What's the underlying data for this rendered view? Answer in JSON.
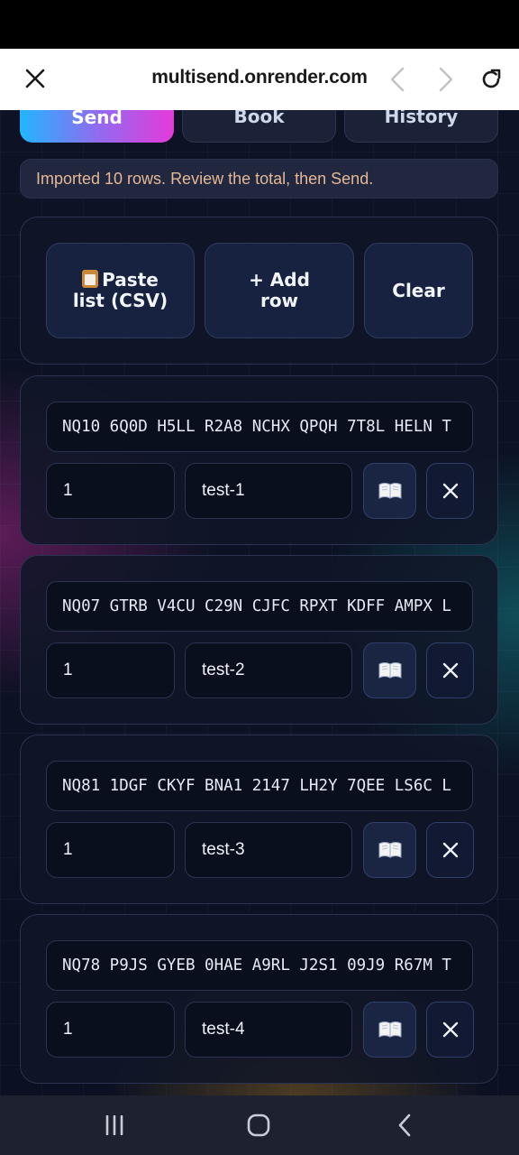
{
  "browser": {
    "url": "multisend.onrender.com"
  },
  "tabs": [
    {
      "label": "Send"
    },
    {
      "label": "Book"
    },
    {
      "label": "History"
    }
  ],
  "notice": "Imported 10 rows. Review the total, then Send.",
  "tools": {
    "paste_label": "Paste list (CSV)",
    "add_label": "+ Add row",
    "clear_label": "Clear"
  },
  "rows": [
    {
      "address": "NQ10 6Q0D H5LL R2A8 NCHX QPQH 7T8L HELN T",
      "amount": "1",
      "memo": "test-1"
    },
    {
      "address": "NQ07 GTRB V4CU C29N CJFC RPXT KDFF AMPX L",
      "amount": "1",
      "memo": "test-2"
    },
    {
      "address": "NQ81 1DGF CKYF BNA1 2147 LH2Y 7QEE LS6C L",
      "amount": "1",
      "memo": "test-3"
    },
    {
      "address": "NQ78 P9JS GYEB 0HAE A9RL J2S1 09J9 R67M T",
      "amount": "1",
      "memo": "test-4"
    }
  ],
  "icons": {
    "close": "close-icon",
    "back": "chevron-left-icon",
    "forward": "chevron-right-icon",
    "reload": "reload-icon",
    "book": "book-icon",
    "delete": "x-icon",
    "clipboard": "clipboard-icon"
  },
  "colors": {
    "accent_gradient_start": "#21b6ff",
    "accent_gradient_end": "#e53ad9",
    "notice_text": "#e4b896"
  }
}
